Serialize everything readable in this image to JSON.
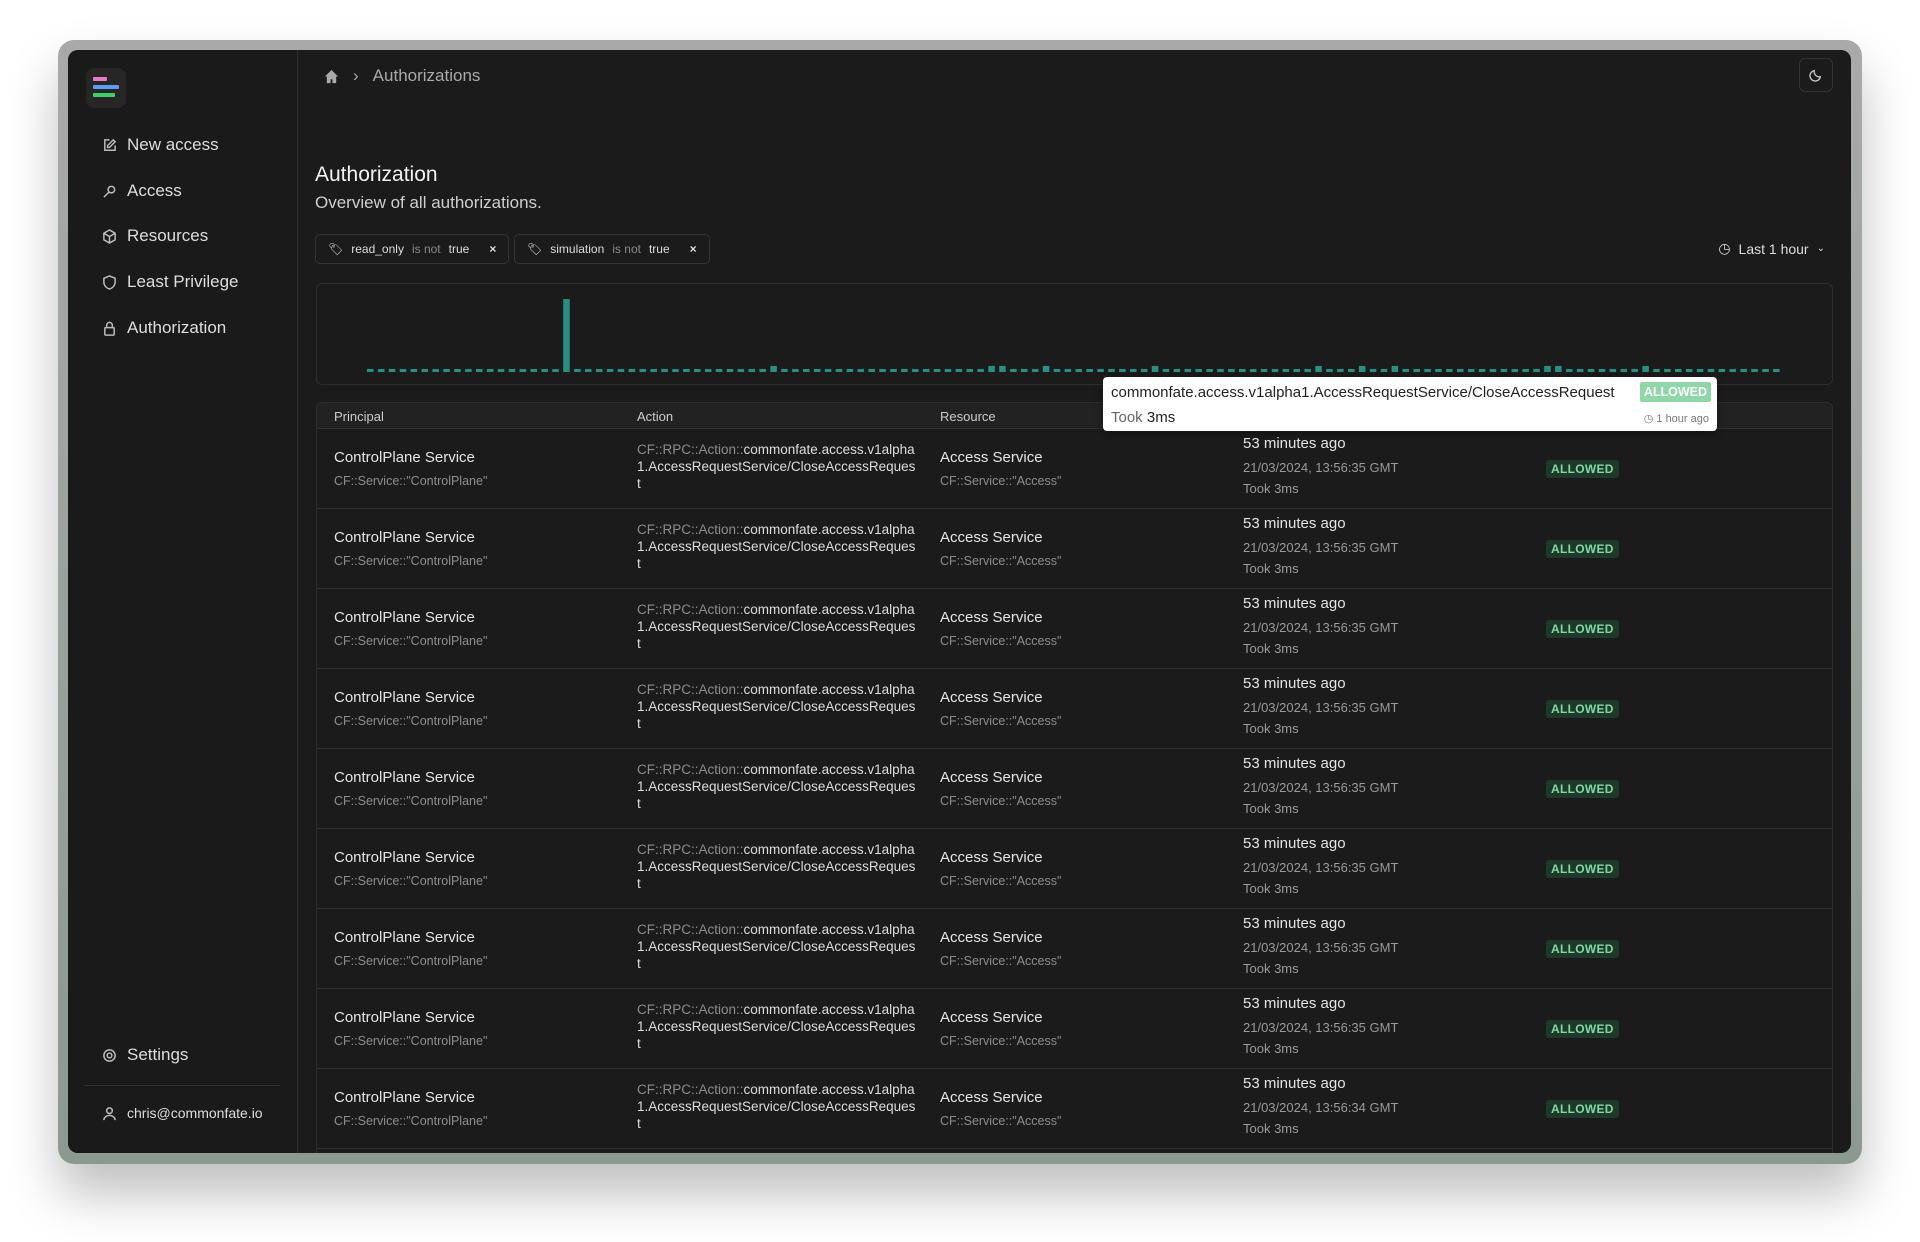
{
  "sidebar": {
    "items": [
      {
        "label": "New access",
        "icon": "edit-icon"
      },
      {
        "label": "Access",
        "icon": "key-icon"
      },
      {
        "label": "Resources",
        "icon": "cube-icon"
      },
      {
        "label": "Least Privilege",
        "icon": "shield-icon"
      },
      {
        "label": "Authorization",
        "icon": "lock-icon"
      }
    ],
    "settings": "Settings",
    "user": "chris@commonfate.io"
  },
  "breadcrumb": {
    "current": "Authorizations"
  },
  "page": {
    "title": "Authorization",
    "subtitle": "Overview of all authorizations."
  },
  "filters": [
    {
      "key": "read_only",
      "op": "is not",
      "value": "true",
      "remove": "×"
    },
    {
      "key": "simulation",
      "op": "is not",
      "value": "true",
      "remove": "×"
    }
  ],
  "time_range": "Last 1 hour",
  "colors": {
    "accent": "#2a8f80",
    "allowed_bg": "#1e3829",
    "allowed_text": "#7fd8a4"
  },
  "chart_data": {
    "type": "bar",
    "title": "",
    "xlabel": "",
    "ylabel": "",
    "values": [
      1,
      1,
      1,
      1,
      1,
      1,
      1,
      1,
      1,
      1,
      1,
      1,
      1,
      1,
      1,
      1,
      1,
      1,
      24,
      1,
      1,
      1,
      1,
      1,
      1,
      1,
      1,
      1,
      1,
      1,
      1,
      1,
      1,
      1,
      1,
      1,
      1,
      2,
      1,
      1,
      1,
      1,
      1,
      1,
      1,
      1,
      1,
      1,
      1,
      1,
      1,
      1,
      1,
      1,
      1,
      1,
      1,
      2,
      2,
      1,
      1,
      1,
      2,
      1,
      1,
      1,
      1,
      1,
      1,
      1,
      1,
      1,
      2,
      1,
      1,
      1,
      1,
      1,
      1,
      1,
      1,
      1,
      1,
      1,
      1,
      1,
      1,
      2,
      1,
      1,
      1,
      2,
      1,
      1,
      2,
      1,
      1,
      1,
      1,
      1,
      1,
      1,
      1,
      1,
      1,
      1,
      1,
      1,
      2,
      2,
      1,
      1,
      1,
      1,
      1,
      1,
      1,
      2,
      1,
      1,
      1,
      1,
      1,
      1,
      1,
      1,
      1,
      1,
      1,
      1
    ],
    "ylim": [
      0,
      25
    ]
  },
  "table": {
    "headers": [
      "Principal",
      "Action",
      "Resource"
    ],
    "rows": [
      {
        "principal": "ControlPlane Service",
        "principal_id": "CF::Service::\"ControlPlane\"",
        "action_prefix": "CF::RPC::Action::",
        "action": "commonfate.access.v1alpha1.AccessRequestService/CloseAccessRequest",
        "resource": "Access Service",
        "resource_id": "CF::Service::\"Access\"",
        "ago": "53 minutes ago",
        "date": "21/03/2024, 13:56:35 GMT",
        "took": "Took 3ms",
        "status": "ALLOWED"
      },
      {
        "principal": "ControlPlane Service",
        "principal_id": "CF::Service::\"ControlPlane\"",
        "action_prefix": "CF::RPC::Action::",
        "action": "commonfate.access.v1alpha1.AccessRequestService/CloseAccessRequest",
        "resource": "Access Service",
        "resource_id": "CF::Service::\"Access\"",
        "ago": "53 minutes ago",
        "date": "21/03/2024, 13:56:35 GMT",
        "took": "Took 3ms",
        "status": "ALLOWED"
      },
      {
        "principal": "ControlPlane Service",
        "principal_id": "CF::Service::\"ControlPlane\"",
        "action_prefix": "CF::RPC::Action::",
        "action": "commonfate.access.v1alpha1.AccessRequestService/CloseAccessRequest",
        "resource": "Access Service",
        "resource_id": "CF::Service::\"Access\"",
        "ago": "53 minutes ago",
        "date": "21/03/2024, 13:56:35 GMT",
        "took": "Took 3ms",
        "status": "ALLOWED"
      },
      {
        "principal": "ControlPlane Service",
        "principal_id": "CF::Service::\"ControlPlane\"",
        "action_prefix": "CF::RPC::Action::",
        "action": "commonfate.access.v1alpha1.AccessRequestService/CloseAccessRequest",
        "resource": "Access Service",
        "resource_id": "CF::Service::\"Access\"",
        "ago": "53 minutes ago",
        "date": "21/03/2024, 13:56:35 GMT",
        "took": "Took 3ms",
        "status": "ALLOWED"
      },
      {
        "principal": "ControlPlane Service",
        "principal_id": "CF::Service::\"ControlPlane\"",
        "action_prefix": "CF::RPC::Action::",
        "action": "commonfate.access.v1alpha1.AccessRequestService/CloseAccessRequest",
        "resource": "Access Service",
        "resource_id": "CF::Service::\"Access\"",
        "ago": "53 minutes ago",
        "date": "21/03/2024, 13:56:35 GMT",
        "took": "Took 3ms",
        "status": "ALLOWED"
      },
      {
        "principal": "ControlPlane Service",
        "principal_id": "CF::Service::\"ControlPlane\"",
        "action_prefix": "CF::RPC::Action::",
        "action": "commonfate.access.v1alpha1.AccessRequestService/CloseAccessRequest",
        "resource": "Access Service",
        "resource_id": "CF::Service::\"Access\"",
        "ago": "53 minutes ago",
        "date": "21/03/2024, 13:56:35 GMT",
        "took": "Took 3ms",
        "status": "ALLOWED"
      },
      {
        "principal": "ControlPlane Service",
        "principal_id": "CF::Service::\"ControlPlane\"",
        "action_prefix": "CF::RPC::Action::",
        "action": "commonfate.access.v1alpha1.AccessRequestService/CloseAccessRequest",
        "resource": "Access Service",
        "resource_id": "CF::Service::\"Access\"",
        "ago": "53 minutes ago",
        "date": "21/03/2024, 13:56:35 GMT",
        "took": "Took 3ms",
        "status": "ALLOWED"
      },
      {
        "principal": "ControlPlane Service",
        "principal_id": "CF::Service::\"ControlPlane\"",
        "action_prefix": "CF::RPC::Action::",
        "action": "commonfate.access.v1alpha1.AccessRequestService/CloseAccessRequest",
        "resource": "Access Service",
        "resource_id": "CF::Service::\"Access\"",
        "ago": "53 minutes ago",
        "date": "21/03/2024, 13:56:35 GMT",
        "took": "Took 3ms",
        "status": "ALLOWED"
      },
      {
        "principal": "ControlPlane Service",
        "principal_id": "CF::Service::\"ControlPlane\"",
        "action_prefix": "CF::RPC::Action::",
        "action": "commonfate.access.v1alpha1.AccessRequestService/CloseAccessRequest",
        "resource": "Access Service",
        "resource_id": "CF::Service::\"Access\"",
        "ago": "53 minutes ago",
        "date": "21/03/2024, 13:56:34 GMT",
        "took": "Took 3ms",
        "status": "ALLOWED"
      }
    ]
  },
  "tooltip": {
    "action": "commonfate.access.v1alpha1.AccessRequestService/CloseAccessRequest",
    "status": "ALLOWED",
    "took_label": "Took",
    "took_value": "3ms",
    "when": "1 hour ago"
  }
}
